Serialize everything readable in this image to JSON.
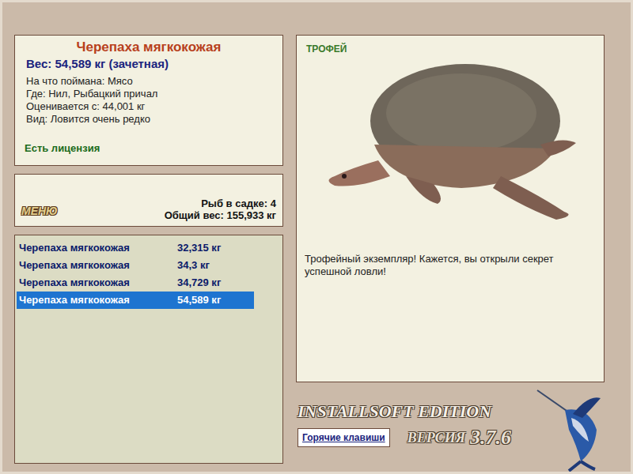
{
  "catch": {
    "name": "Черепаха мягкокожая",
    "weight": "Вес: 54,589 кг (зачетная)",
    "details": [
      "На что поймана: Мясо",
      "Где: Нил, Рыбацкий причал",
      "Оценивается с: 44,001 кг",
      "Вид: Ловится очень редко"
    ],
    "license": "Есть лицензия"
  },
  "keepnet": {
    "menu_button": "МЕНЮ",
    "count": "Рыб в садке: 4",
    "total": "Общий вес: 155,933 кг"
  },
  "fish_list": [
    {
      "name": "Черепаха мягкокожая",
      "weight": "32,315 кг",
      "selected": false
    },
    {
      "name": "Черепаха мягкокожая",
      "weight": "34,3 кг",
      "selected": false
    },
    {
      "name": "Черепаха мягкокожая",
      "weight": "34,729 кг",
      "selected": false
    },
    {
      "name": "Черепаха мягкокожая",
      "weight": "54,589 кг",
      "selected": true
    }
  ],
  "trophy": {
    "label": "ТРОФЕЙ",
    "message": "Трофейный экземпляр! Кажется, вы открыли секрет успешной ловли!"
  },
  "footer": {
    "edition": "INSTALLSOFT EDITION",
    "version_label": "ВЕРСИЯ",
    "version": "3.7.6",
    "hotkeys": "Горячие клавиши"
  }
}
